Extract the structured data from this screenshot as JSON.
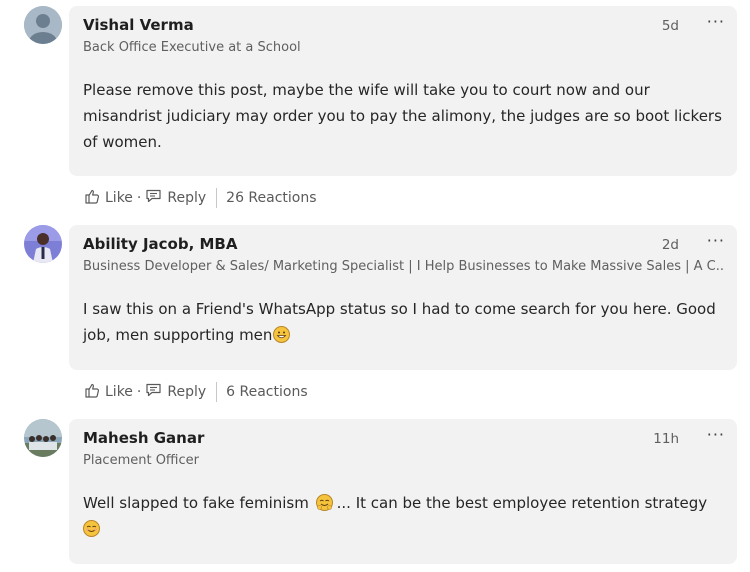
{
  "comments": [
    {
      "name": "Vishal Verma",
      "headline": "Back Office Executive at a School",
      "time": "5d",
      "more": "···",
      "text": "Please remove this post, maybe the wife will take you to court now and our misandrist judiciary may order you to pay the alimony, the judges are so boot lickers of women.",
      "like": "Like",
      "reply": "Reply",
      "reactions": "26 Reactions"
    },
    {
      "name": "Ability Jacob, MBA",
      "headline": "Business Developer & Sales/ Marketing Specialist | I Help Businesses to Make Massive Sales | A C...",
      "time": "2d",
      "more": "···",
      "text": "I saw this on a Friend's WhatsApp status so I had to come search for you here. Good job, men supporting men",
      "emoji": "grinning-sweat-emoji",
      "like": "Like",
      "reply": "Reply",
      "reactions": "6 Reactions"
    },
    {
      "name": "Mahesh Ganar",
      "headline": "Placement Officer",
      "time": "11h",
      "more": "···",
      "text_a": "Well slapped to fake feminism",
      "text_b": "... It can be the best  employee retention strategy",
      "emoji_a": "hugging-face-emoji",
      "emoji_b": "smiling-face-emoji"
    }
  ],
  "action_separator": "·",
  "colors": {
    "bubble": "#f2f2f2",
    "muted_text": "#5f5f5f"
  }
}
